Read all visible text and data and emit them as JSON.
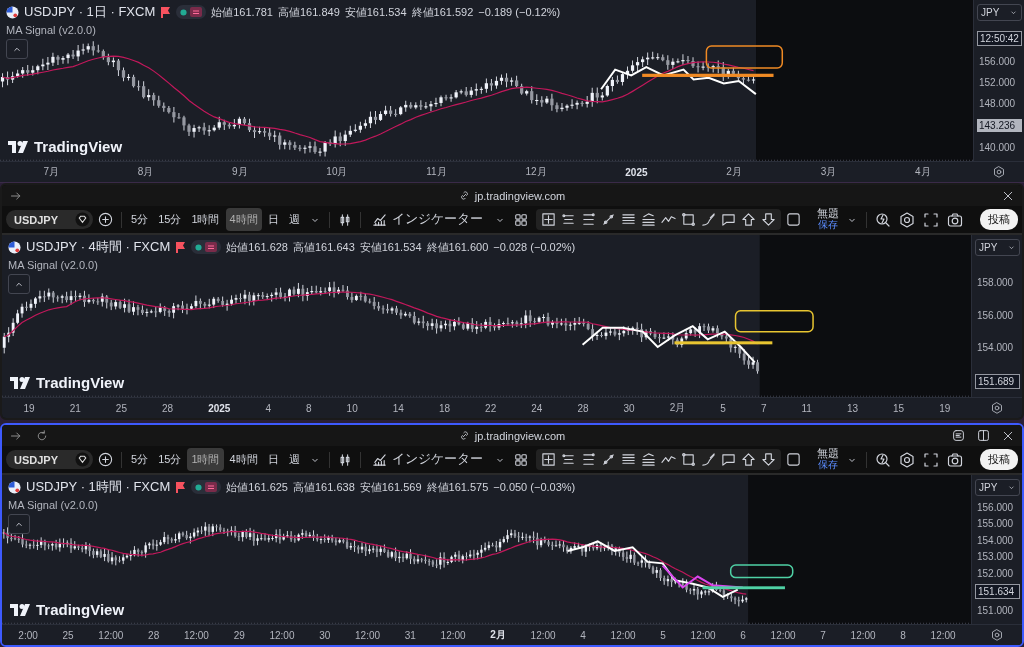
{
  "top_chart": {
    "symbol": "USDJPY · 1日 · FXCM",
    "ohlc": [
      "始値161.781",
      "高値161.849",
      "安値161.534",
      "終値161.592"
    ],
    "change": "−0.189 (−0.12%)",
    "indicator": "MA Signal (v2.0.0)",
    "logo": "TradingView",
    "currency": "JPY",
    "price_labels": [
      {
        "text": "12:50:42",
        "kind": "badge"
      },
      {
        "text": "156.000",
        "kind": "tick"
      },
      {
        "text": "152.000",
        "kind": "tick"
      },
      {
        "text": "148.000",
        "kind": "tick"
      },
      {
        "text": "143.236",
        "kind": "light-badge"
      },
      {
        "text": "140.000",
        "kind": "tick"
      }
    ],
    "time_labels": [
      {
        "text": "7月",
        "bold": false
      },
      {
        "text": "8月",
        "bold": false
      },
      {
        "text": "9月",
        "bold": false
      },
      {
        "text": "10月",
        "bold": false
      },
      {
        "text": "11月",
        "bold": false
      },
      {
        "text": "12月",
        "bold": false
      },
      {
        "text": "2025",
        "bold": true
      },
      {
        "text": "2月",
        "bold": false
      },
      {
        "text": "3月",
        "bold": false
      },
      {
        "text": "4月",
        "bold": false
      }
    ]
  },
  "windows": [
    {
      "active": false,
      "show_reload": false,
      "show_panel_buttons": false,
      "url": "jp.tradingview.com",
      "toolbar": {
        "symbol": "USDJPY",
        "intervals": [
          {
            "label": "5分",
            "selected": false
          },
          {
            "label": "15分",
            "selected": false
          },
          {
            "label": "1時間",
            "selected": false
          },
          {
            "label": "4時間",
            "selected": true
          },
          {
            "label": "日",
            "selected": false
          },
          {
            "label": "週",
            "selected": false
          }
        ],
        "indicators": "インジケーター",
        "layout_name": "無題",
        "save": "保存",
        "publish": "投稿"
      },
      "chart": {
        "symbol": "USDJPY · 4時間 · FXCM",
        "ohlc": [
          "始値161.628",
          "高値161.643",
          "安値161.534",
          "終値161.600"
        ],
        "change": "−0.028 (−0.02%)",
        "indicator": "MA Signal (v2.0.0)",
        "logo": "TradingView",
        "currency": "JPY",
        "price_labels": [
          {
            "text": "158.000",
            "kind": "tick"
          },
          {
            "text": "156.000",
            "kind": "tick"
          },
          {
            "text": "154.000",
            "kind": "tick"
          },
          {
            "text": "151.689",
            "kind": "badge"
          }
        ],
        "time_labels": [
          {
            "text": "19",
            "bold": false
          },
          {
            "text": "21",
            "bold": false
          },
          {
            "text": "25",
            "bold": false
          },
          {
            "text": "28",
            "bold": false
          },
          {
            "text": "2025",
            "bold": true
          },
          {
            "text": "4",
            "bold": false
          },
          {
            "text": "8",
            "bold": false
          },
          {
            "text": "10",
            "bold": false
          },
          {
            "text": "14",
            "bold": false
          },
          {
            "text": "18",
            "bold": false
          },
          {
            "text": "22",
            "bold": false
          },
          {
            "text": "24",
            "bold": false
          },
          {
            "text": "28",
            "bold": false
          },
          {
            "text": "30",
            "bold": false
          },
          {
            "text": "2月",
            "bold": false
          },
          {
            "text": "5",
            "bold": false
          },
          {
            "text": "7",
            "bold": false
          },
          {
            "text": "11",
            "bold": false
          },
          {
            "text": "13",
            "bold": false
          },
          {
            "text": "15",
            "bold": false
          },
          {
            "text": "19",
            "bold": false
          }
        ]
      }
    },
    {
      "active": true,
      "show_reload": true,
      "show_panel_buttons": true,
      "url": "jp.tradingview.com",
      "toolbar": {
        "symbol": "USDJPY",
        "intervals": [
          {
            "label": "5分",
            "selected": false
          },
          {
            "label": "15分",
            "selected": false
          },
          {
            "label": "1時間",
            "selected": true
          },
          {
            "label": "4時間",
            "selected": false
          },
          {
            "label": "日",
            "selected": false
          },
          {
            "label": "週",
            "selected": false
          }
        ],
        "indicators": "インジケーター",
        "layout_name": "無題",
        "save": "保存",
        "publish": "投稿"
      },
      "chart": {
        "symbol": "USDJPY · 1時間 · FXCM",
        "ohlc": [
          "始値161.625",
          "高値161.638",
          "安値161.569",
          "終値161.575"
        ],
        "change": "−0.050 (−0.03%)",
        "indicator": "MA Signal (v2.0.0)",
        "logo": "TradingView",
        "currency": "JPY",
        "price_labels": [
          {
            "text": "156.000",
            "kind": "tick"
          },
          {
            "text": "155.000",
            "kind": "tick"
          },
          {
            "text": "154.000",
            "kind": "tick"
          },
          {
            "text": "153.000",
            "kind": "tick"
          },
          {
            "text": "152.000",
            "kind": "tick"
          },
          {
            "text": "151.634",
            "kind": "badge"
          },
          {
            "text": "151.000",
            "kind": "tick"
          }
        ],
        "time_labels": [
          {
            "text": "2:00",
            "bold": false
          },
          {
            "text": "25",
            "bold": false
          },
          {
            "text": "12:00",
            "bold": false
          },
          {
            "text": "28",
            "bold": false
          },
          {
            "text": "12:00",
            "bold": false
          },
          {
            "text": "29",
            "bold": false
          },
          {
            "text": "12:00",
            "bold": false
          },
          {
            "text": "30",
            "bold": false
          },
          {
            "text": "12:00",
            "bold": false
          },
          {
            "text": "31",
            "bold": false
          },
          {
            "text": "12:00",
            "bold": false
          },
          {
            "text": "2月",
            "bold": true
          },
          {
            "text": "12:00",
            "bold": false
          },
          {
            "text": "4",
            "bold": false
          },
          {
            "text": "12:00",
            "bold": false
          },
          {
            "text": "5",
            "bold": false
          },
          {
            "text": "12:00",
            "bold": false
          },
          {
            "text": "6",
            "bold": false
          },
          {
            "text": "12:00",
            "bold": false
          },
          {
            "text": "7",
            "bold": false
          },
          {
            "text": "12:00",
            "bold": false
          },
          {
            "text": "8",
            "bold": false
          },
          {
            "text": "12:00",
            "bold": false
          }
        ]
      }
    }
  ]
}
